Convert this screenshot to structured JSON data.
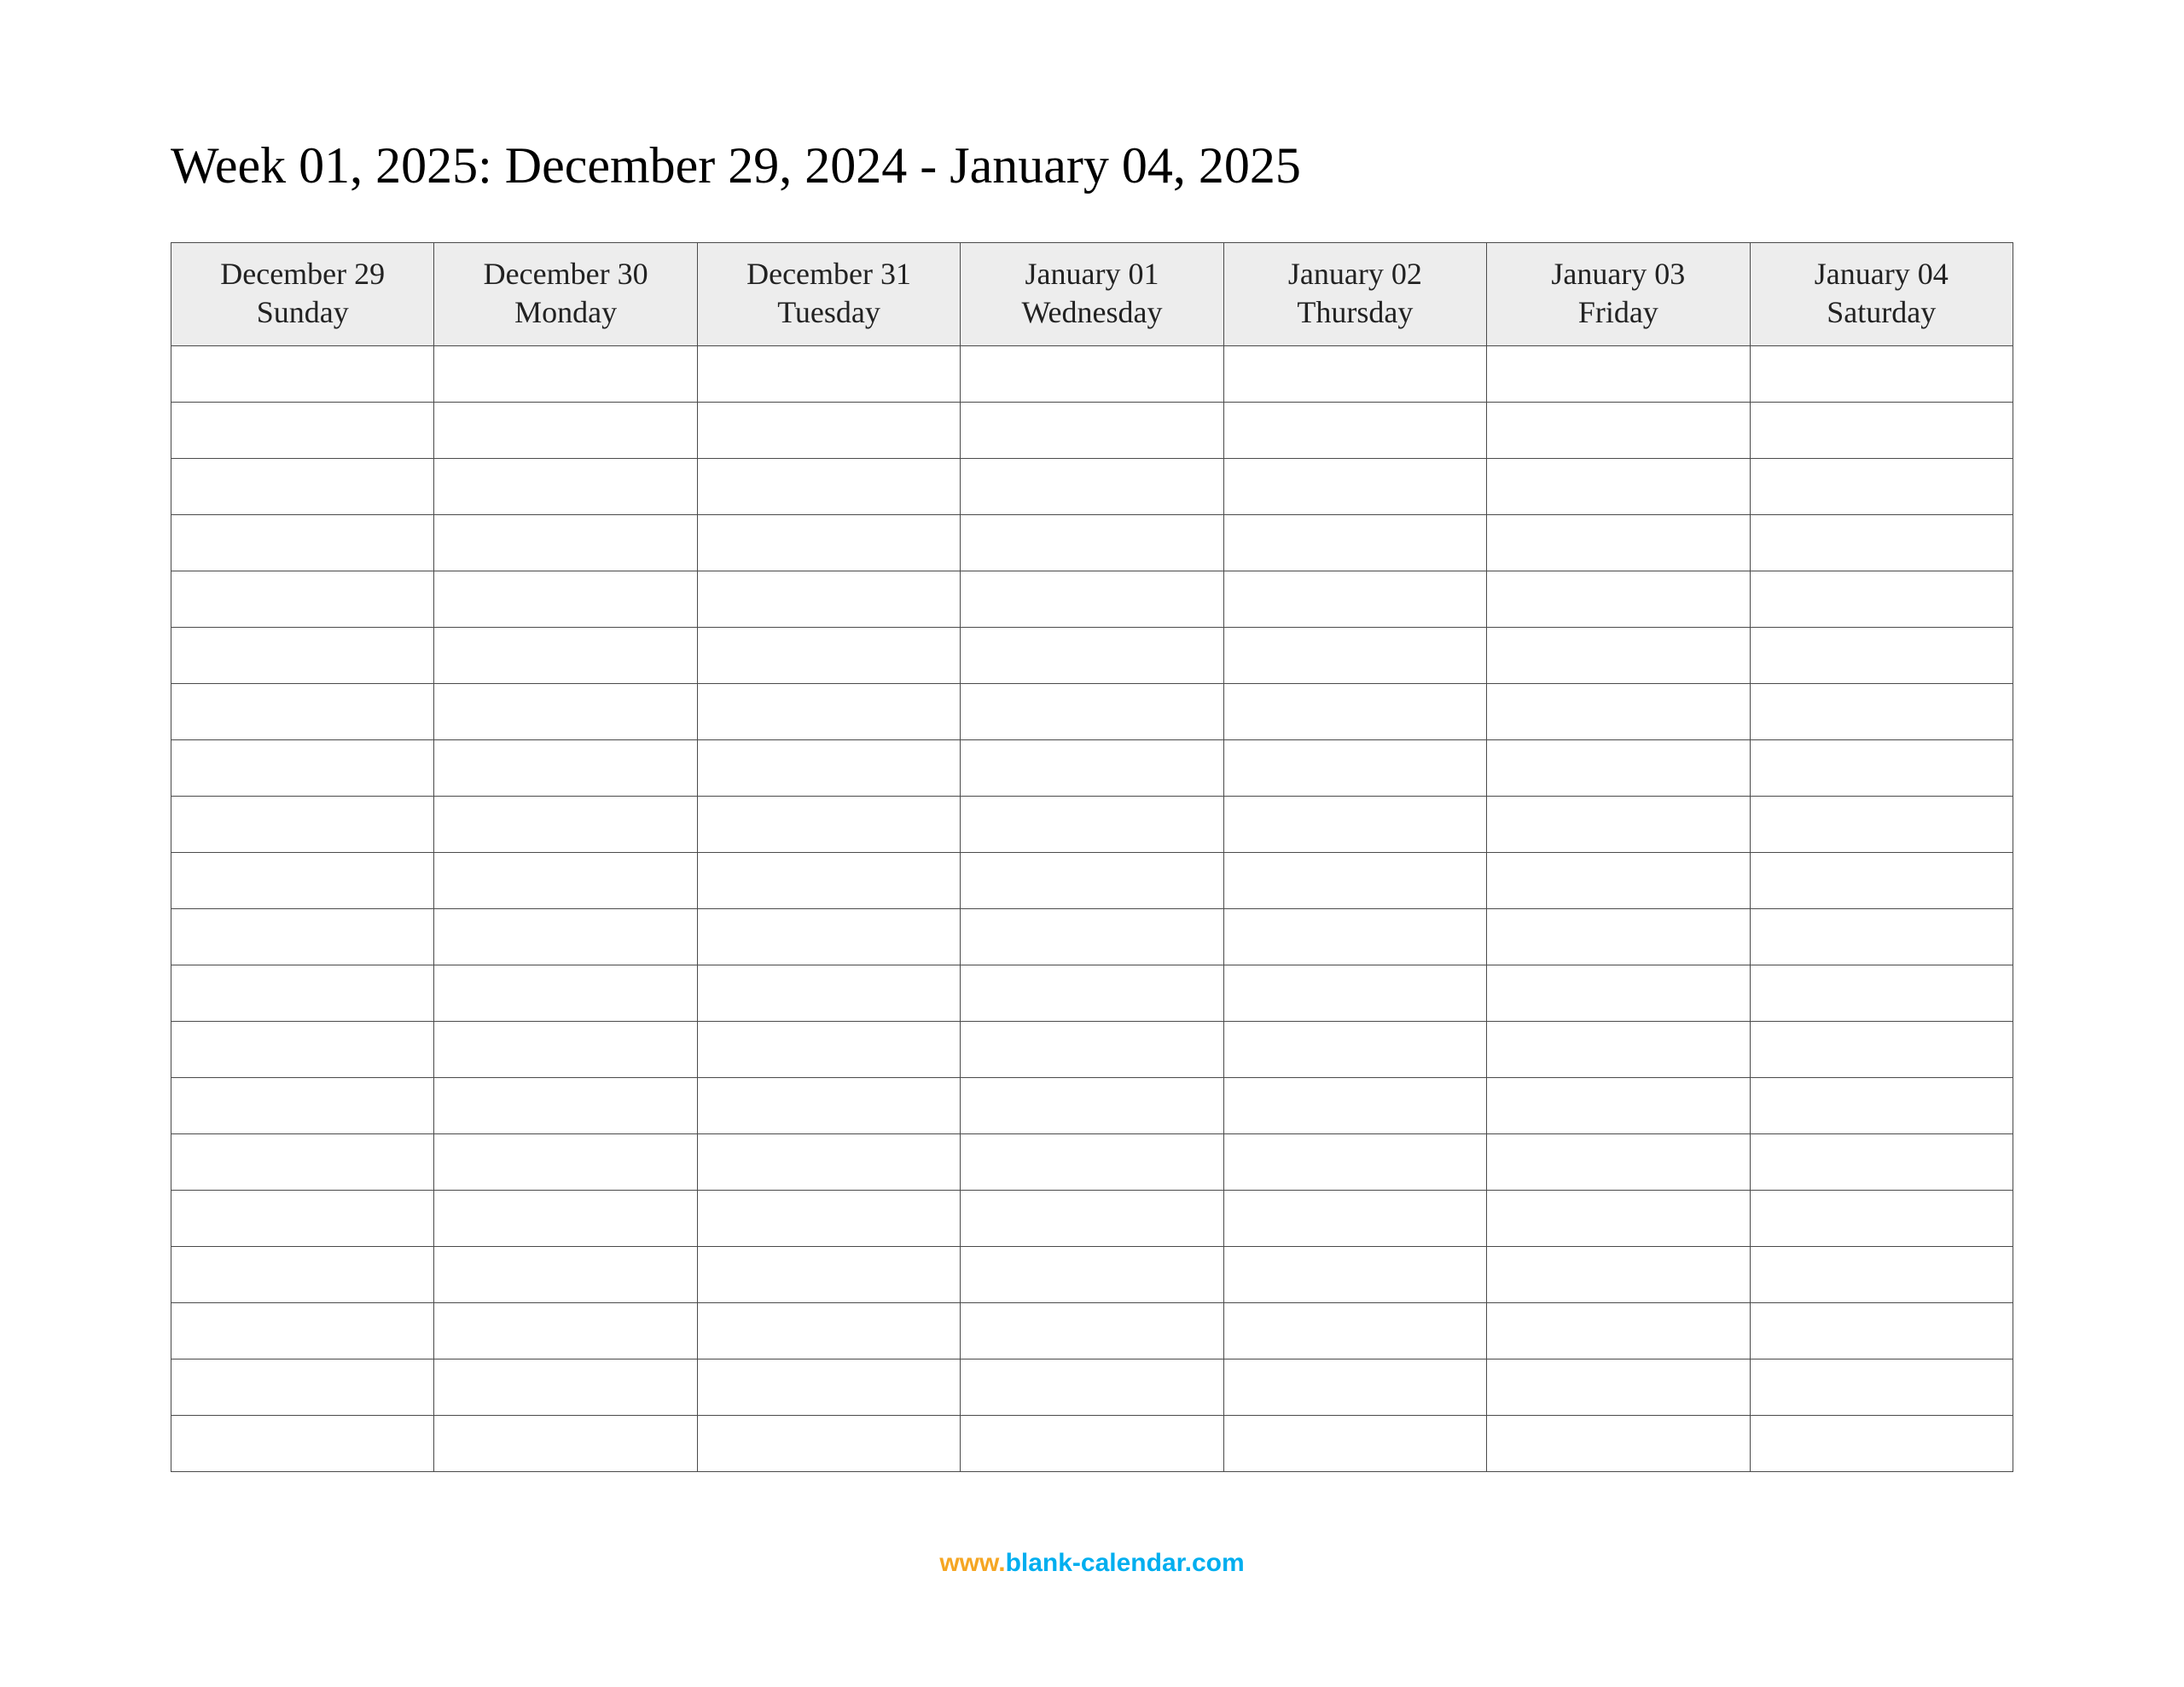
{
  "title": "Week 01, 2025: December 29, 2024 - January 04, 2025",
  "columns": [
    {
      "date": "December 29",
      "day": "Sunday"
    },
    {
      "date": "December 30",
      "day": "Monday"
    },
    {
      "date": "December 31",
      "day": "Tuesday"
    },
    {
      "date": "January 01",
      "day": "Wednesday"
    },
    {
      "date": "January 02",
      "day": "Thursday"
    },
    {
      "date": "January 03",
      "day": "Friday"
    },
    {
      "date": "January 04",
      "day": "Saturday"
    }
  ],
  "row_count": 20,
  "footer": {
    "prefix": "www.",
    "domain": "blank-calendar.com"
  }
}
